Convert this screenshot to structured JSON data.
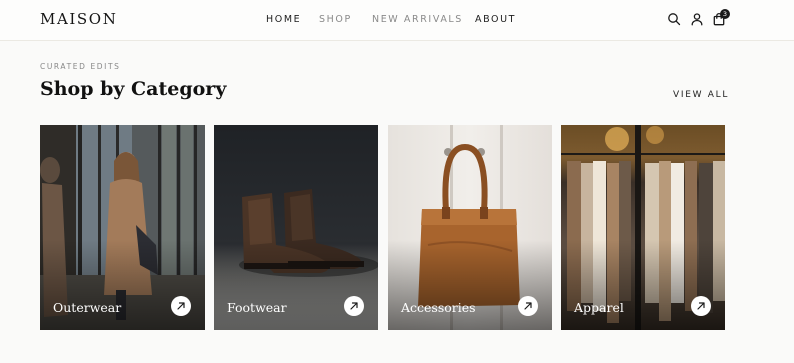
{
  "brand": {
    "logo": "MAISON"
  },
  "nav": {
    "items": [
      {
        "label": "HOME",
        "active": true
      },
      {
        "label": "SHOP",
        "active": false
      },
      {
        "label": "NEW ARRIVALS",
        "active": false
      },
      {
        "label": "ABOUT",
        "active": true
      }
    ]
  },
  "header_icons": {
    "search": "search-icon",
    "account": "user-icon",
    "cart": "shopping-bag-icon",
    "cart_count": "3"
  },
  "section": {
    "eyebrow": "CURATED EDITS",
    "title": "Shop by Category",
    "view_all": "VIEW ALL"
  },
  "categories": [
    {
      "label": "Outerwear",
      "icon": "arrow-up-right-icon"
    },
    {
      "label": "Footwear",
      "icon": "arrow-up-right-icon"
    },
    {
      "label": "Accessories",
      "icon": "arrow-up-right-icon"
    },
    {
      "label": "Apparel",
      "icon": "arrow-up-right-icon"
    }
  ],
  "colors": {
    "background": "#fafaf9",
    "text": "#1a1a1a",
    "muted": "#8a8a8a",
    "card_label": "#ffffff"
  }
}
